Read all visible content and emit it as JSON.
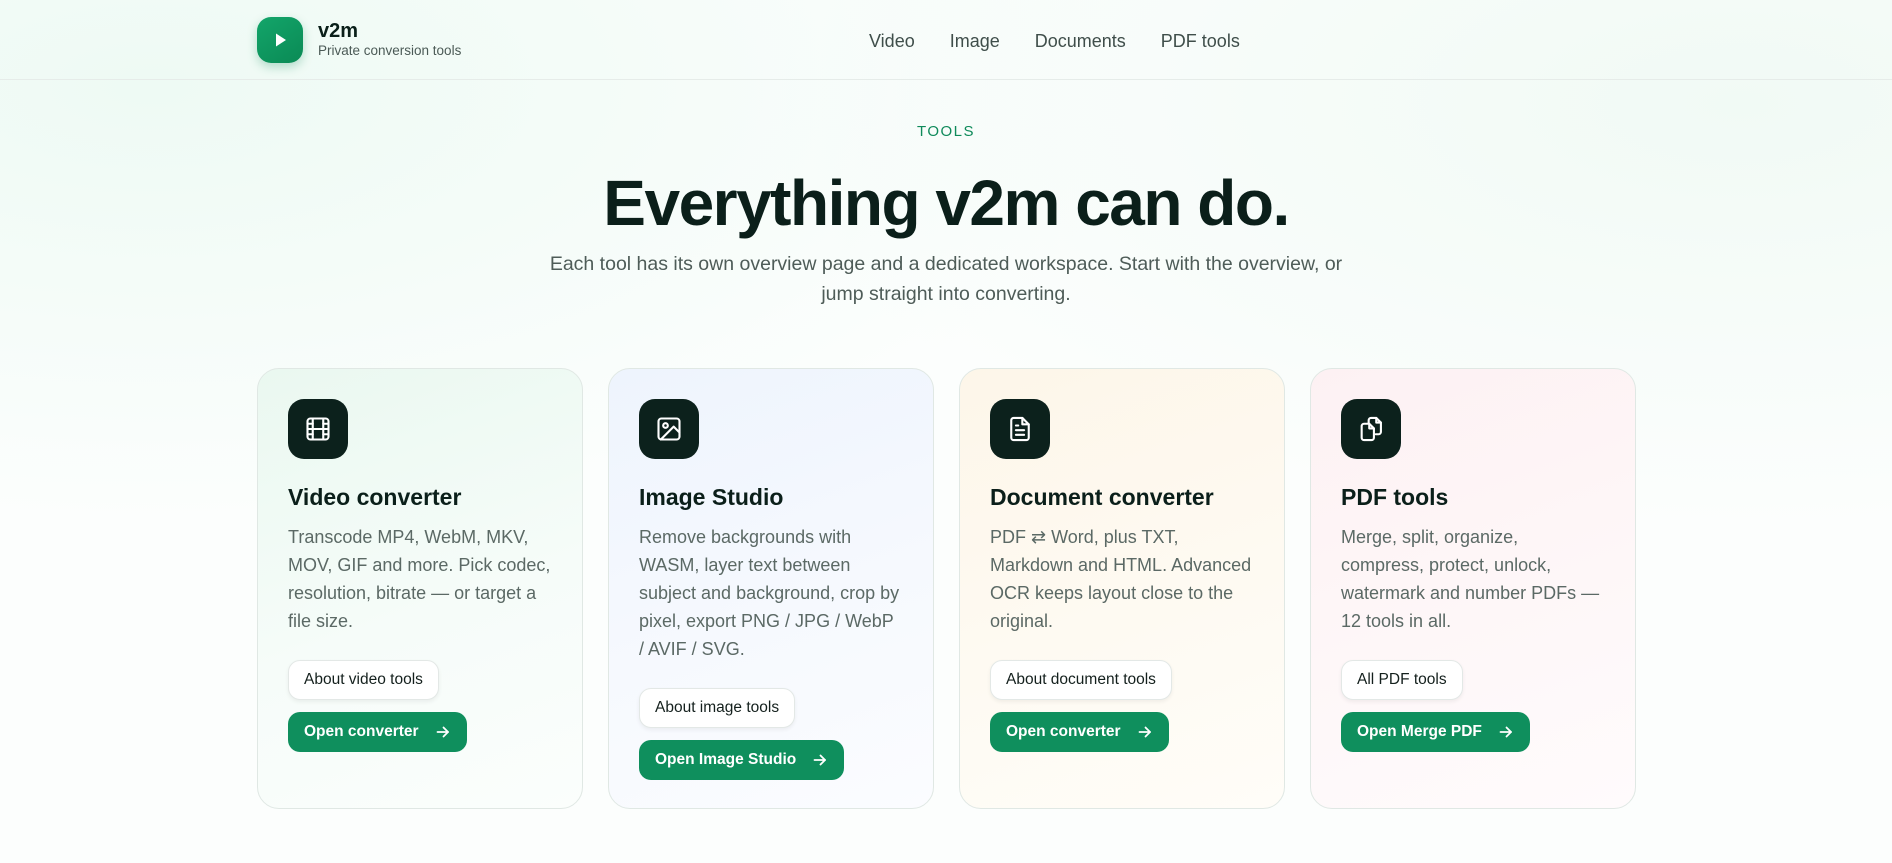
{
  "header": {
    "brand": {
      "name": "v2m",
      "tagline": "Private conversion tools",
      "logo_icon": "play-icon"
    },
    "nav": [
      {
        "label": "Video"
      },
      {
        "label": "Image"
      },
      {
        "label": "Documents"
      },
      {
        "label": "PDF tools"
      }
    ]
  },
  "hero": {
    "eyebrow": "TOOLS",
    "title": "Everything v2m can do.",
    "subtitle": "Each tool has its own overview page and a dedicated workspace. Start with the overview, or jump straight into converting."
  },
  "cards": [
    {
      "icon": "film-icon",
      "title": "Video converter",
      "description": "Transcode MP4, WebM, MKV, MOV, GIF and more. Pick codec, resolution, bitrate — or target a file size.",
      "about_label": "About video tools",
      "open_label": "Open converter"
    },
    {
      "icon": "image-icon",
      "title": "Image Studio",
      "description": "Remove backgrounds with WASM, layer text between subject and background, crop by pixel, export PNG / JPG / WebP / AVIF / SVG.",
      "about_label": "About image tools",
      "open_label": "Open Image Studio"
    },
    {
      "icon": "document-icon",
      "title": "Document converter",
      "description": "PDF ⇄ Word, plus TXT, Markdown and HTML. Advanced OCR keeps layout close to the original.",
      "about_label": "About document tools",
      "open_label": "Open converter"
    },
    {
      "icon": "copy-files-icon",
      "title": "PDF tools",
      "description": "Merge, split, organize, compress, protect, unlock, watermark and number PDFs — 12 tools in all.",
      "about_label": "All PDF tools",
      "open_label": "Open Merge PDF"
    }
  ],
  "colors": {
    "accent": "#0f8f5d",
    "brand_green": "#13a56a",
    "icon_tile": "#0c211c",
    "text_dark": "#0b1f1a",
    "text_muted": "#5b6965"
  }
}
